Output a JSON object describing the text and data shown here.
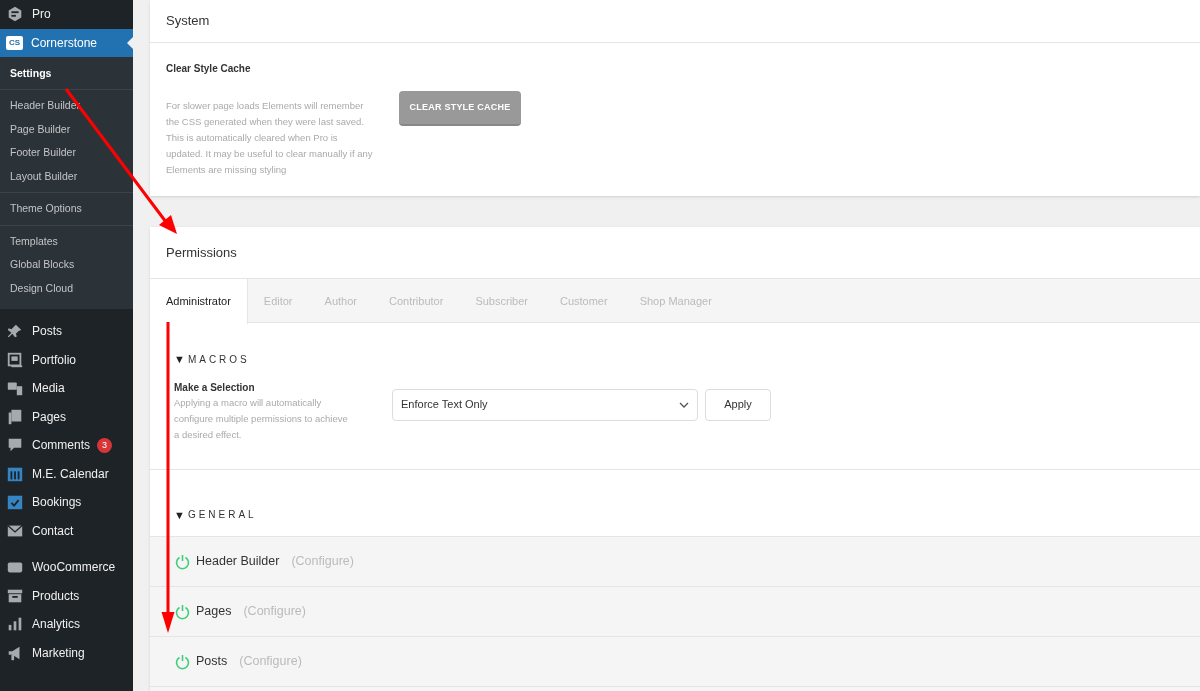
{
  "sidebar": {
    "groups": [
      [
        {
          "label": "Pro",
          "selected": false
        },
        {
          "label": "Cornerstone",
          "icon_text": "CS",
          "selected": true,
          "submenu": [
            [
              {
                "label": "Settings",
                "selected": true
              }
            ],
            [
              {
                "label": "Header Builder",
                "selected": false
              },
              {
                "label": "Page Builder",
                "selected": false
              },
              {
                "label": "Footer Builder",
                "selected": false
              },
              {
                "label": "Layout Builder",
                "selected": false
              }
            ],
            [
              {
                "label": "Theme Options",
                "selected": false
              }
            ],
            [
              {
                "label": "Templates",
                "selected": false
              },
              {
                "label": "Global Blocks",
                "selected": false
              },
              {
                "label": "Design Cloud",
                "selected": false
              }
            ]
          ]
        }
      ],
      [
        {
          "label": "Posts",
          "selected": false
        },
        {
          "label": "Portfolio",
          "selected": false
        },
        {
          "label": "Media",
          "selected": false
        },
        {
          "label": "Pages",
          "selected": false
        },
        {
          "label": "Comments",
          "badge": "3",
          "selected": false
        },
        {
          "label": "M.E. Calendar",
          "selected": false
        },
        {
          "label": "Bookings",
          "selected": false
        },
        {
          "label": "Contact",
          "selected": false
        }
      ],
      [
        {
          "label": "WooCommerce",
          "selected": false
        },
        {
          "label": "Products",
          "selected": false
        },
        {
          "label": "Analytics",
          "selected": false
        },
        {
          "label": "Marketing",
          "selected": false
        }
      ]
    ]
  },
  "system": {
    "title": "System",
    "setting": {
      "label": "Clear Style Cache",
      "description": "For slower page loads Elements will remember the CSS generated when they were last saved. This is automatically cleared when Pro is updated. It may be useful to clear manually if any Elements are missing styling",
      "button": "CLEAR STYLE CACHE"
    }
  },
  "permissions": {
    "title": "Permissions",
    "tabs": [
      {
        "label": "Administrator",
        "selected": true
      },
      {
        "label": "Editor",
        "selected": false
      },
      {
        "label": "Author",
        "selected": false
      },
      {
        "label": "Contributor",
        "selected": false
      },
      {
        "label": "Subscriber",
        "selected": false
      },
      {
        "label": "Customer",
        "selected": false
      },
      {
        "label": "Shop Manager",
        "selected": false
      }
    ],
    "macros": {
      "toggle": "▼",
      "title": "MACROS",
      "label": "Make a Selection",
      "description": "Applying a macro will automatically configure multiple permissions to achieve a desired effect.",
      "select_value": "Enforce Text Only",
      "button": "Apply"
    },
    "general": {
      "toggle": "▼",
      "title": "GENERAL",
      "rows": [
        {
          "label": "Header Builder",
          "link": "(Configure)",
          "on": true
        },
        {
          "label": "Pages",
          "link": "(Configure)",
          "on": true
        },
        {
          "label": "Posts",
          "link": "(Configure)",
          "on": true
        }
      ]
    }
  }
}
